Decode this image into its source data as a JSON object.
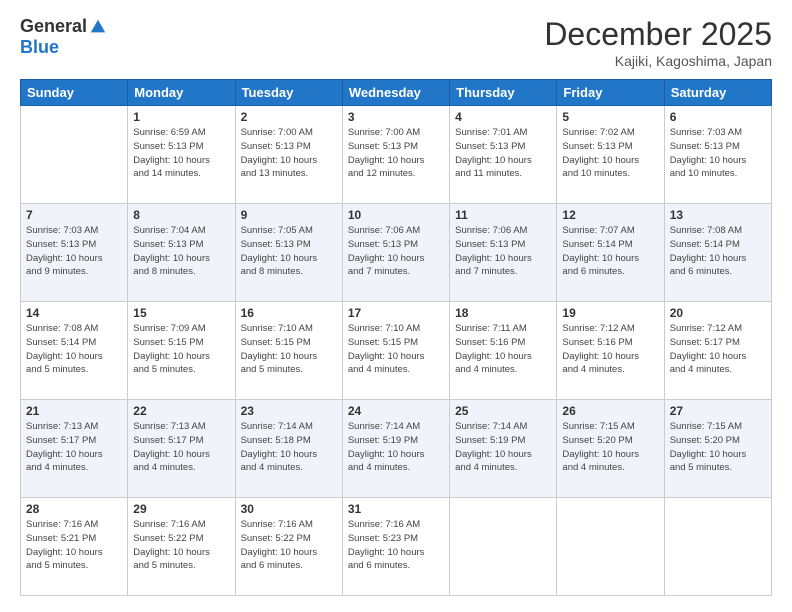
{
  "header": {
    "logo": {
      "general": "General",
      "blue": "Blue"
    },
    "title": "December 2025",
    "location": "Kajiki, Kagoshima, Japan"
  },
  "days_of_week": [
    "Sunday",
    "Monday",
    "Tuesday",
    "Wednesday",
    "Thursday",
    "Friday",
    "Saturday"
  ],
  "weeks": [
    [
      {
        "day": "",
        "info": ""
      },
      {
        "day": "1",
        "info": "Sunrise: 6:59 AM\nSunset: 5:13 PM\nDaylight: 10 hours\nand 14 minutes."
      },
      {
        "day": "2",
        "info": "Sunrise: 7:00 AM\nSunset: 5:13 PM\nDaylight: 10 hours\nand 13 minutes."
      },
      {
        "day": "3",
        "info": "Sunrise: 7:00 AM\nSunset: 5:13 PM\nDaylight: 10 hours\nand 12 minutes."
      },
      {
        "day": "4",
        "info": "Sunrise: 7:01 AM\nSunset: 5:13 PM\nDaylight: 10 hours\nand 11 minutes."
      },
      {
        "day": "5",
        "info": "Sunrise: 7:02 AM\nSunset: 5:13 PM\nDaylight: 10 hours\nand 10 minutes."
      },
      {
        "day": "6",
        "info": "Sunrise: 7:03 AM\nSunset: 5:13 PM\nDaylight: 10 hours\nand 10 minutes."
      }
    ],
    [
      {
        "day": "7",
        "info": "Sunrise: 7:03 AM\nSunset: 5:13 PM\nDaylight: 10 hours\nand 9 minutes."
      },
      {
        "day": "8",
        "info": "Sunrise: 7:04 AM\nSunset: 5:13 PM\nDaylight: 10 hours\nand 8 minutes."
      },
      {
        "day": "9",
        "info": "Sunrise: 7:05 AM\nSunset: 5:13 PM\nDaylight: 10 hours\nand 8 minutes."
      },
      {
        "day": "10",
        "info": "Sunrise: 7:06 AM\nSunset: 5:13 PM\nDaylight: 10 hours\nand 7 minutes."
      },
      {
        "day": "11",
        "info": "Sunrise: 7:06 AM\nSunset: 5:13 PM\nDaylight: 10 hours\nand 7 minutes."
      },
      {
        "day": "12",
        "info": "Sunrise: 7:07 AM\nSunset: 5:14 PM\nDaylight: 10 hours\nand 6 minutes."
      },
      {
        "day": "13",
        "info": "Sunrise: 7:08 AM\nSunset: 5:14 PM\nDaylight: 10 hours\nand 6 minutes."
      }
    ],
    [
      {
        "day": "14",
        "info": "Sunrise: 7:08 AM\nSunset: 5:14 PM\nDaylight: 10 hours\nand 5 minutes."
      },
      {
        "day": "15",
        "info": "Sunrise: 7:09 AM\nSunset: 5:15 PM\nDaylight: 10 hours\nand 5 minutes."
      },
      {
        "day": "16",
        "info": "Sunrise: 7:10 AM\nSunset: 5:15 PM\nDaylight: 10 hours\nand 5 minutes."
      },
      {
        "day": "17",
        "info": "Sunrise: 7:10 AM\nSunset: 5:15 PM\nDaylight: 10 hours\nand 4 minutes."
      },
      {
        "day": "18",
        "info": "Sunrise: 7:11 AM\nSunset: 5:16 PM\nDaylight: 10 hours\nand 4 minutes."
      },
      {
        "day": "19",
        "info": "Sunrise: 7:12 AM\nSunset: 5:16 PM\nDaylight: 10 hours\nand 4 minutes."
      },
      {
        "day": "20",
        "info": "Sunrise: 7:12 AM\nSunset: 5:17 PM\nDaylight: 10 hours\nand 4 minutes."
      }
    ],
    [
      {
        "day": "21",
        "info": "Sunrise: 7:13 AM\nSunset: 5:17 PM\nDaylight: 10 hours\nand 4 minutes."
      },
      {
        "day": "22",
        "info": "Sunrise: 7:13 AM\nSunset: 5:17 PM\nDaylight: 10 hours\nand 4 minutes."
      },
      {
        "day": "23",
        "info": "Sunrise: 7:14 AM\nSunset: 5:18 PM\nDaylight: 10 hours\nand 4 minutes."
      },
      {
        "day": "24",
        "info": "Sunrise: 7:14 AM\nSunset: 5:19 PM\nDaylight: 10 hours\nand 4 minutes."
      },
      {
        "day": "25",
        "info": "Sunrise: 7:14 AM\nSunset: 5:19 PM\nDaylight: 10 hours\nand 4 minutes."
      },
      {
        "day": "26",
        "info": "Sunrise: 7:15 AM\nSunset: 5:20 PM\nDaylight: 10 hours\nand 4 minutes."
      },
      {
        "day": "27",
        "info": "Sunrise: 7:15 AM\nSunset: 5:20 PM\nDaylight: 10 hours\nand 5 minutes."
      }
    ],
    [
      {
        "day": "28",
        "info": "Sunrise: 7:16 AM\nSunset: 5:21 PM\nDaylight: 10 hours\nand 5 minutes."
      },
      {
        "day": "29",
        "info": "Sunrise: 7:16 AM\nSunset: 5:22 PM\nDaylight: 10 hours\nand 5 minutes."
      },
      {
        "day": "30",
        "info": "Sunrise: 7:16 AM\nSunset: 5:22 PM\nDaylight: 10 hours\nand 6 minutes."
      },
      {
        "day": "31",
        "info": "Sunrise: 7:16 AM\nSunset: 5:23 PM\nDaylight: 10 hours\nand 6 minutes."
      },
      {
        "day": "",
        "info": ""
      },
      {
        "day": "",
        "info": ""
      },
      {
        "day": "",
        "info": ""
      }
    ]
  ]
}
